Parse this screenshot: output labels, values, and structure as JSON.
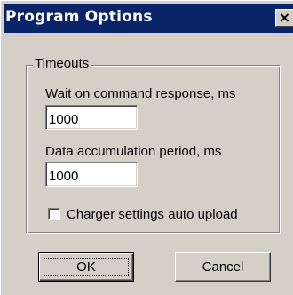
{
  "window": {
    "title": "Program Options",
    "close_glyph": "×"
  },
  "timeouts": {
    "group_label": "Timeouts",
    "command_response_label": "Wait on command response, ms",
    "command_response_value": "1000",
    "accumulation_label": "Data accumulation period, ms",
    "accumulation_value": "1000",
    "auto_upload_label": "Charger settings auto upload",
    "auto_upload_checked": false
  },
  "buttons": {
    "ok_label": "OK",
    "cancel_label": "Cancel"
  },
  "colors": {
    "titlebar": "#0a246a",
    "face": "#d4d0c8"
  },
  "icons": {
    "close": "close-icon"
  }
}
